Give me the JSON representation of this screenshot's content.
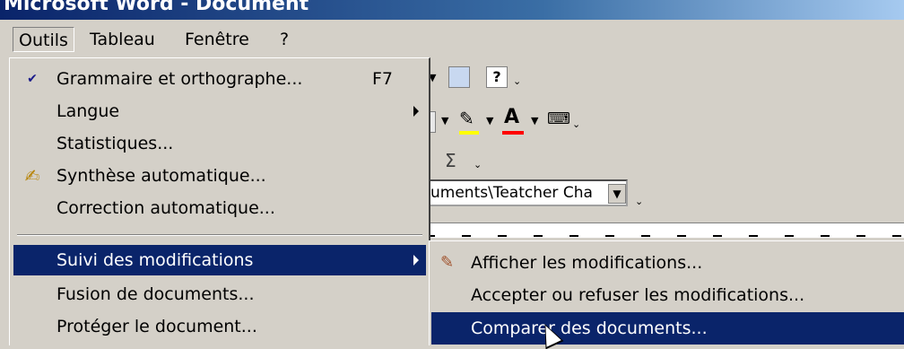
{
  "titlebar": {
    "text": "Microsoft Word - Document"
  },
  "menubar": {
    "items": [
      {
        "label": "Outils"
      },
      {
        "label": "Tableau"
      },
      {
        "label": "Fenêtre"
      },
      {
        "label": "?"
      }
    ]
  },
  "toolbar": {
    "address_value": "uments\\Teatcher Cha",
    "sigma": "Σ"
  },
  "tools_menu": {
    "items": [
      {
        "label": "Grammaire et orthographe...",
        "shortcut": "F7",
        "icon": "spelling-check-icon"
      },
      {
        "label": "Langue",
        "submenu": true
      },
      {
        "label": "Statistiques..."
      },
      {
        "label": "Synthèse automatique...",
        "icon": "auto-summarize-icon"
      },
      {
        "label": "Correction automatique..."
      },
      {
        "label": "Suivi des modifications",
        "submenu": true,
        "selected": true
      },
      {
        "label": "Fusion de documents..."
      },
      {
        "label": "Protéger le document..."
      }
    ]
  },
  "track_changes_submenu": {
    "items": [
      {
        "label": "Afficher les modifications...",
        "icon": "highlight-changes-icon"
      },
      {
        "label": "Accepter ou refuser les modifications..."
      },
      {
        "label": "Comparer des documents...",
        "selected": true
      }
    ]
  },
  "colors": {
    "menu_bg": "#d4d0c8",
    "highlight": "#0a246a",
    "highlight_text": "#ffffff"
  }
}
